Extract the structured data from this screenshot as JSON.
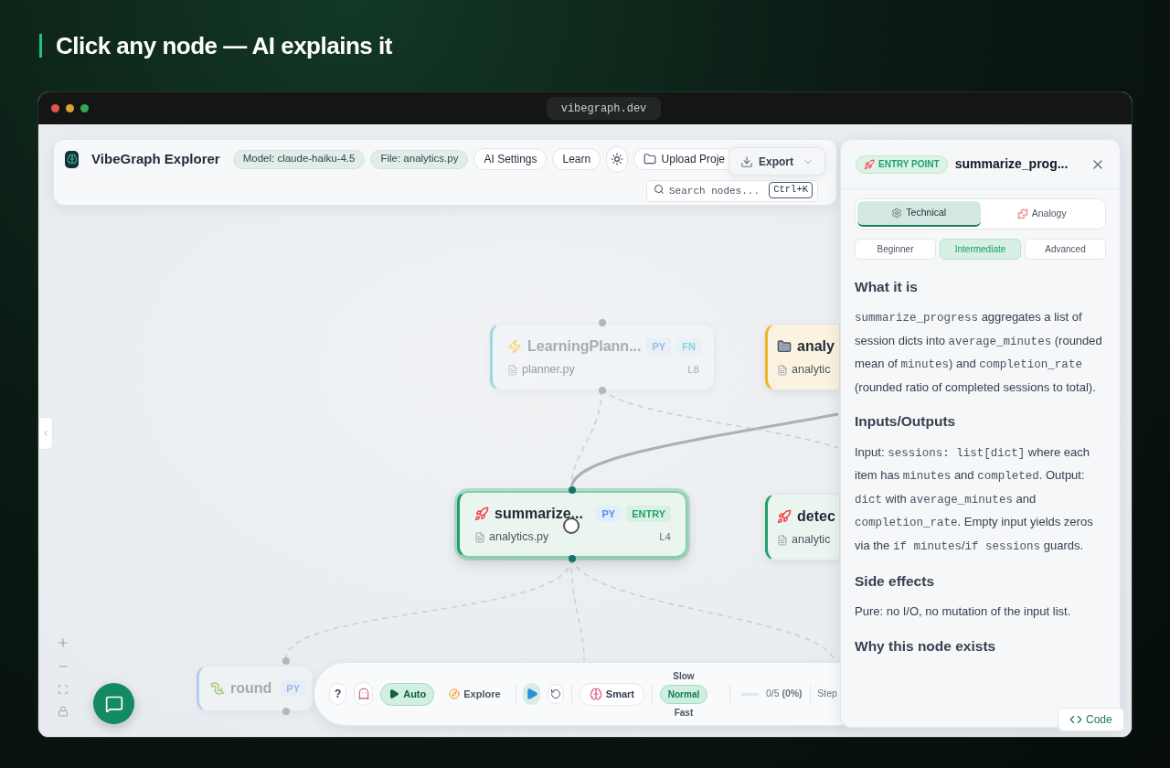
{
  "headline": "Click any node — AI explains it",
  "browser": {
    "url": "vibegraph.dev"
  },
  "toolbar": {
    "title": "VibeGraph Explorer",
    "chips": [
      "Model: claude-haiku-4.5",
      "File: analytics.py"
    ],
    "buttons": [
      "AI Settings",
      "Learn"
    ],
    "upload_button": "Upload Proje",
    "export_button": "Export",
    "search": {
      "placeholder": "Search nodes...",
      "shortcut": "Ctrl+K"
    }
  },
  "nodes": [
    {
      "kind": "function",
      "title": "LearningPlann...",
      "tags": [
        {
          "label": "PY",
          "kind": "lang"
        },
        {
          "label": "FN",
          "kind": "fn"
        }
      ],
      "file": "planner.py",
      "line": "L8",
      "selected": false,
      "dimmed": true
    },
    {
      "kind": "module",
      "title": "analy",
      "file": "analytic",
      "selected": false,
      "dimmed": false
    },
    {
      "kind": "entry",
      "title": "summarize...",
      "tags": [
        {
          "label": "PY",
          "kind": "lang"
        },
        {
          "label": "ENTRY",
          "kind": "entry"
        }
      ],
      "file": "analytics.py",
      "line": "L4",
      "selected": true,
      "dimmed": false
    },
    {
      "kind": "entry",
      "title": "detec",
      "file": "analytic",
      "selected": false,
      "dimmed": false
    },
    {
      "kind": "builtin",
      "title": "round",
      "tags": [
        {
          "label": "PY",
          "kind": "lang"
        }
      ],
      "selected": false,
      "dimmed": true
    }
  ],
  "controls": {
    "help": "?",
    "modes": [
      {
        "label": "Auto",
        "selected": true
      },
      {
        "label": "Explore",
        "selected": false
      }
    ],
    "smart_button": "Smart",
    "speeds": [
      {
        "label": "Slow",
        "selected": false
      },
      {
        "label": "Normal",
        "selected": true
      },
      {
        "label": "Fast",
        "selected": false
      }
    ],
    "progress": {
      "level": 0,
      "reading": "0/5 **(0%)**"
    },
    "step": "Step"
  },
  "panel": {
    "badge": "ENTRY POINT",
    "title": "summarize_prog...",
    "view_tabs": [
      {
        "label": "Technical",
        "selected": true
      },
      {
        "label": "Analogy",
        "selected": false
      }
    ],
    "levels": [
      {
        "label": "Beginner",
        "selected": false
      },
      {
        "label": "Intermediate",
        "selected": true
      },
      {
        "label": "Advanced",
        "selected": false
      }
    ],
    "sections": [
      {
        "heading": "What it is",
        "segments": [
          {
            "kind": "code",
            "text": "summarize_progress"
          },
          {
            "kind": "text",
            "text": " aggregates a list of session dicts into "
          },
          {
            "kind": "code",
            "text": "average_minutes"
          },
          {
            "kind": "text",
            "text": " (rounded mean of "
          },
          {
            "kind": "code",
            "text": "minutes"
          },
          {
            "kind": "text",
            "text": ") and "
          },
          {
            "kind": "code",
            "text": "completion_rate"
          },
          {
            "kind": "text",
            "text": " (rounded ratio of completed sessions to total)."
          }
        ]
      },
      {
        "heading": "Inputs/Outputs",
        "segments": [
          {
            "kind": "text",
            "text": "Input: "
          },
          {
            "kind": "code",
            "text": "sessions: list[dict]"
          },
          {
            "kind": "text",
            "text": " where each item has "
          },
          {
            "kind": "code",
            "text": "minutes"
          },
          {
            "kind": "text",
            "text": " and "
          },
          {
            "kind": "code",
            "text": "completed"
          },
          {
            "kind": "text",
            "text": ". Output: "
          },
          {
            "kind": "code",
            "text": "dict"
          },
          {
            "kind": "text",
            "text": " with "
          },
          {
            "kind": "code",
            "text": "average_minutes"
          },
          {
            "kind": "text",
            "text": " and "
          },
          {
            "kind": "code",
            "text": "completion_rate"
          },
          {
            "kind": "text",
            "text": ". Empty input yields zeros via the "
          },
          {
            "kind": "code",
            "text": "if minutes"
          },
          {
            "kind": "text",
            "text": "/"
          },
          {
            "kind": "code",
            "text": "if sessions"
          },
          {
            "kind": "text",
            "text": " guards."
          }
        ]
      },
      {
        "heading": "Side effects",
        "segments": [
          {
            "kind": "text",
            "text": "Pure: no I/O, no mutation of the input list."
          }
        ]
      },
      {
        "heading": "Why this node exists"
      }
    ],
    "code_button": "Code"
  }
}
